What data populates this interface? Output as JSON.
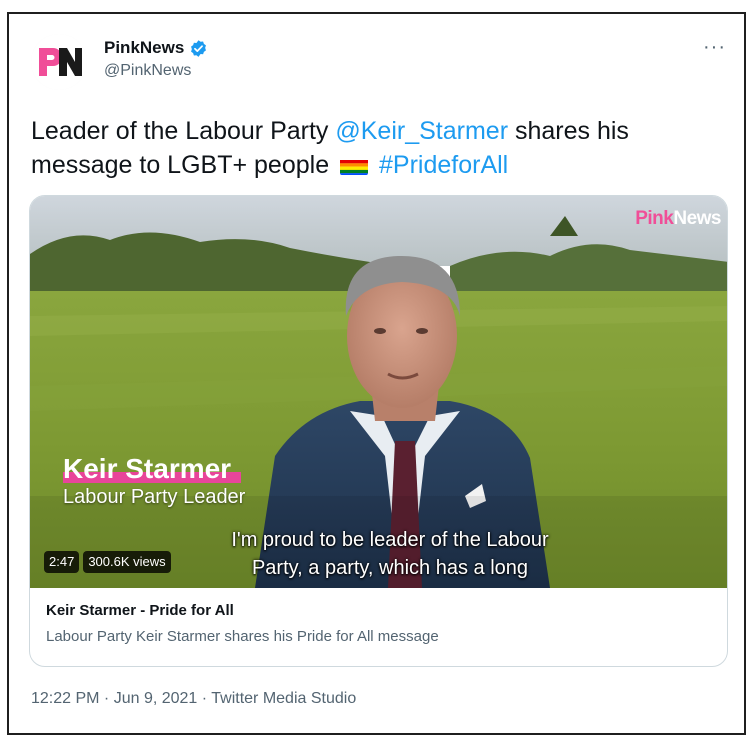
{
  "author": {
    "name": "PinkNews",
    "handle": "@PinkNews",
    "avatar_text": "PN",
    "verified_icon": "verified-badge-icon"
  },
  "menu": {
    "more_label": "···"
  },
  "tweet": {
    "text_part1": "Leader of the Labour Party ",
    "mention": "@Keir_Starmer",
    "text_part2": " shares his message to LGBT+ people",
    "flag_icon": "rainbow-flag-icon",
    "hashtag": "#PrideforAll"
  },
  "video": {
    "watermark_pink": "Pink",
    "watermark_white": "News",
    "lower_third_name": "Keir Starmer",
    "lower_third_title": "Labour Party Leader",
    "subtitle_line1": "I'm proud to be leader of the Labour",
    "subtitle_line2": "Party, a party, which has a long",
    "duration": "2:47",
    "views": "300.6K views"
  },
  "card": {
    "title": "Keir Starmer - Pride for All",
    "description": "Labour Party Keir Starmer shares his Pride for All message"
  },
  "footer": {
    "time": "12:22 PM",
    "separator1": " · ",
    "date": "Jun 9, 2021",
    "separator2": " · ",
    "source": "Twitter Media Studio"
  },
  "colors": {
    "link": "#1d9bf0",
    "secondary_text": "#536471",
    "brand_pink": "#f04e98"
  }
}
